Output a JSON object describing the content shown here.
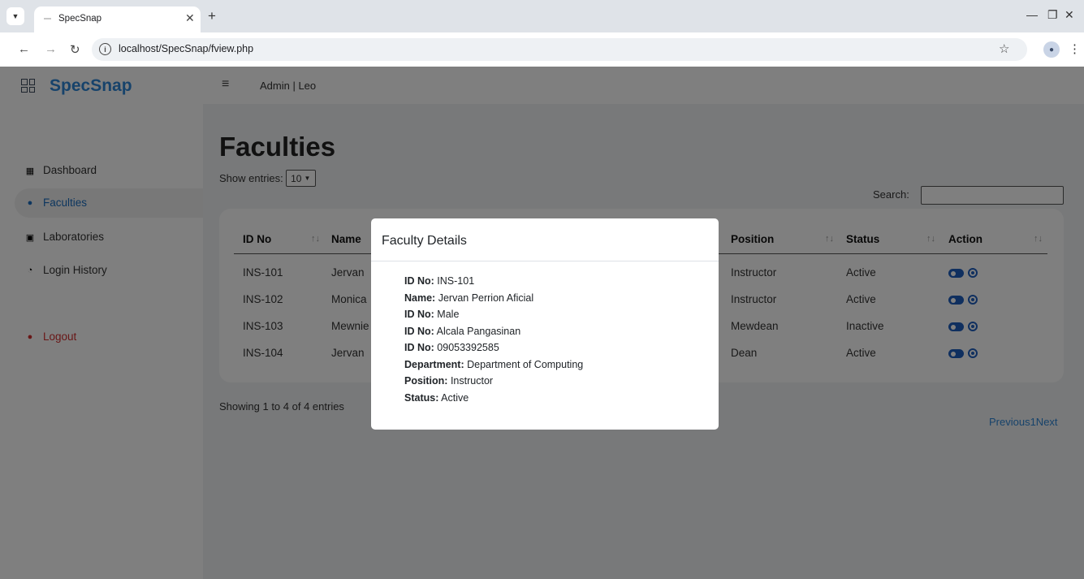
{
  "browser": {
    "tab_title": "SpecSnap",
    "url": "localhost/SpecSnap/fview.php"
  },
  "sidebar": {
    "brand": "SpecSnap",
    "items": [
      {
        "label": "Dashboard",
        "icon": "dashboard-icon"
      },
      {
        "label": "Faculties",
        "icon": "users-icon",
        "active": true
      },
      {
        "label": "Laboratories",
        "icon": "lab-icon"
      },
      {
        "label": "Login History",
        "icon": "history-icon"
      }
    ],
    "logout": "Logout"
  },
  "topbar": {
    "admin_label": "Admin | Leo"
  },
  "main": {
    "title": "Faculties",
    "show_entries_label": "Show entries:",
    "entries_value": "10",
    "search_label": "Search:",
    "showing_text": "Showing 1 to 4 of 4 entries",
    "pager_text": "Previous1Next"
  },
  "table": {
    "headers": [
      "ID No",
      "Name",
      "Position",
      "Status",
      "Action"
    ],
    "rows": [
      {
        "id": "INS-101",
        "name": "Jervan",
        "position": "Instructor",
        "status": "Active",
        "toggle": "on"
      },
      {
        "id": "INS-102",
        "name": "Monica",
        "position": "Instructor",
        "status": "Active",
        "toggle": "on"
      },
      {
        "id": "INS-103",
        "name": "Mewnie",
        "position": "Mewdean",
        "status": "Inactive",
        "toggle": "off"
      },
      {
        "id": "INS-104",
        "name": "Jervan",
        "position": "Dean",
        "status": "Active",
        "toggle": "on"
      }
    ]
  },
  "modal": {
    "title": "Faculty Details",
    "details": [
      {
        "label": "ID No:",
        "value": "INS-101"
      },
      {
        "label": "Name:",
        "value": "Jervan Perrion Aficial"
      },
      {
        "label": "ID No:",
        "value": "Male"
      },
      {
        "label": "ID No:",
        "value": "Alcala Pangasinan"
      },
      {
        "label": "ID No:",
        "value": "09053392585"
      },
      {
        "label": "Department:",
        "value": "Department of Computing"
      },
      {
        "label": "Position:",
        "value": "Instructor"
      },
      {
        "label": "Status:",
        "value": "Active"
      }
    ]
  },
  "colors": {
    "brand": "#2f86d6",
    "action": "#1f5fbf",
    "logout": "#d32f2f"
  }
}
